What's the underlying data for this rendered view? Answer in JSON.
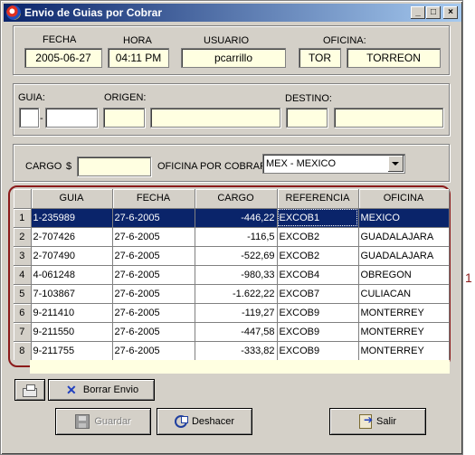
{
  "window": {
    "title": "Envio de Guias por Cobrar",
    "controls": [
      "_",
      "□",
      "×"
    ]
  },
  "header": {
    "fecha": {
      "label": "FECHA",
      "value": "2005-06-27"
    },
    "hora": {
      "label": "HORA",
      "value": "04:11 PM"
    },
    "usuario": {
      "label": "USUARIO",
      "value": "pcarrillo"
    },
    "oficina": {
      "label": "OFICINA:",
      "code": "TOR",
      "name": "TORREON"
    }
  },
  "guia_section": {
    "guia_label": "GUIA:",
    "dash": "-",
    "origen_label": "ORIGEN:",
    "destino_label": "DESTINO:"
  },
  "cargo": {
    "label": "CARGO",
    "currency": "$",
    "oficina_label": "OFICINA POR COBRAR:",
    "oficina_value": "MEX - MEXICO"
  },
  "table": {
    "columns": [
      "GUIA",
      "FECHA",
      "CARGO",
      "REFERENCIA",
      "OFICINA"
    ],
    "rows": [
      {
        "n": "1",
        "guia": "1-235989",
        "fecha": "27-6-2005",
        "cargo": "-446,22",
        "referencia": "EXCOB1",
        "oficina": "MEXICO"
      },
      {
        "n": "2",
        "guia": "2-707426",
        "fecha": "27-6-2005",
        "cargo": "-116,5",
        "referencia": "EXCOB2",
        "oficina": "GUADALAJARA"
      },
      {
        "n": "3",
        "guia": "2-707490",
        "fecha": "27-6-2005",
        "cargo": "-522,69",
        "referencia": "EXCOB2",
        "oficina": "GUADALAJARA"
      },
      {
        "n": "4",
        "guia": "4-061248",
        "fecha": "27-6-2005",
        "cargo": "-980,33",
        "referencia": "EXCOB4",
        "oficina": "OBREGON"
      },
      {
        "n": "5",
        "guia": "7-103867",
        "fecha": "27-6-2005",
        "cargo": "-1.622,22",
        "referencia": "EXCOB7",
        "oficina": "CULIACAN"
      },
      {
        "n": "6",
        "guia": "9-211410",
        "fecha": "27-6-2005",
        "cargo": "-119,27",
        "referencia": "EXCOB9",
        "oficina": "MONTERREY"
      },
      {
        "n": "7",
        "guia": "9-211550",
        "fecha": "27-6-2005",
        "cargo": "-447,58",
        "referencia": "EXCOB9",
        "oficina": "MONTERREY"
      },
      {
        "n": "8",
        "guia": "9-211755",
        "fecha": "27-6-2005",
        "cargo": "-333,82",
        "referencia": "EXCOB9",
        "oficina": "MONTERREY"
      }
    ],
    "selected_row": 1
  },
  "annotation": "1",
  "buttons": {
    "borrar_envio": "Borrar Envio",
    "guardar": "Guardar",
    "deshacer": "Deshacer",
    "salir": "Salir"
  },
  "colors": {
    "accent_outline": "#8b1a1a",
    "selection": "#0a246a",
    "field_bg": "#ffffe1"
  }
}
